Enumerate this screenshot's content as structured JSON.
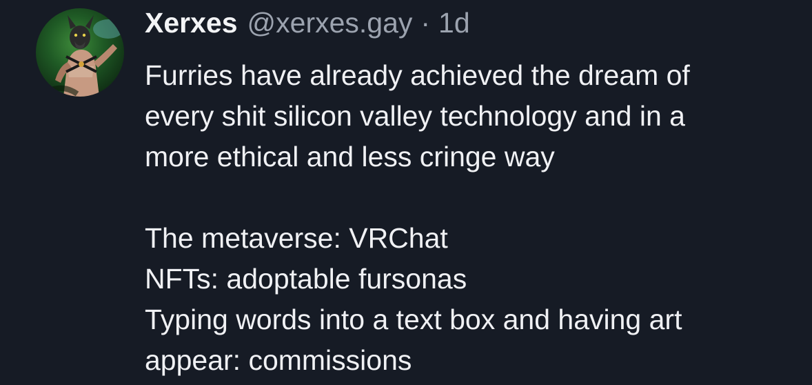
{
  "post": {
    "author": {
      "display_name": "Xerxes",
      "handle": "@xerxes.gay",
      "avatar_icon": "user-avatar-image"
    },
    "separator": "·",
    "timestamp": "1d",
    "lines": [
      "Furries have already achieved the dream of",
      "every shit silicon valley technology and in a",
      "more ethical and less cringe way",
      "",
      "The metaverse: VRChat",
      "NFTs: adoptable fursonas",
      "Typing words into a text box and having art",
      "appear: commissions"
    ]
  },
  "colors": {
    "background": "#161b25",
    "text_primary": "#f0f1f4",
    "text_secondary": "#9ca3af"
  }
}
